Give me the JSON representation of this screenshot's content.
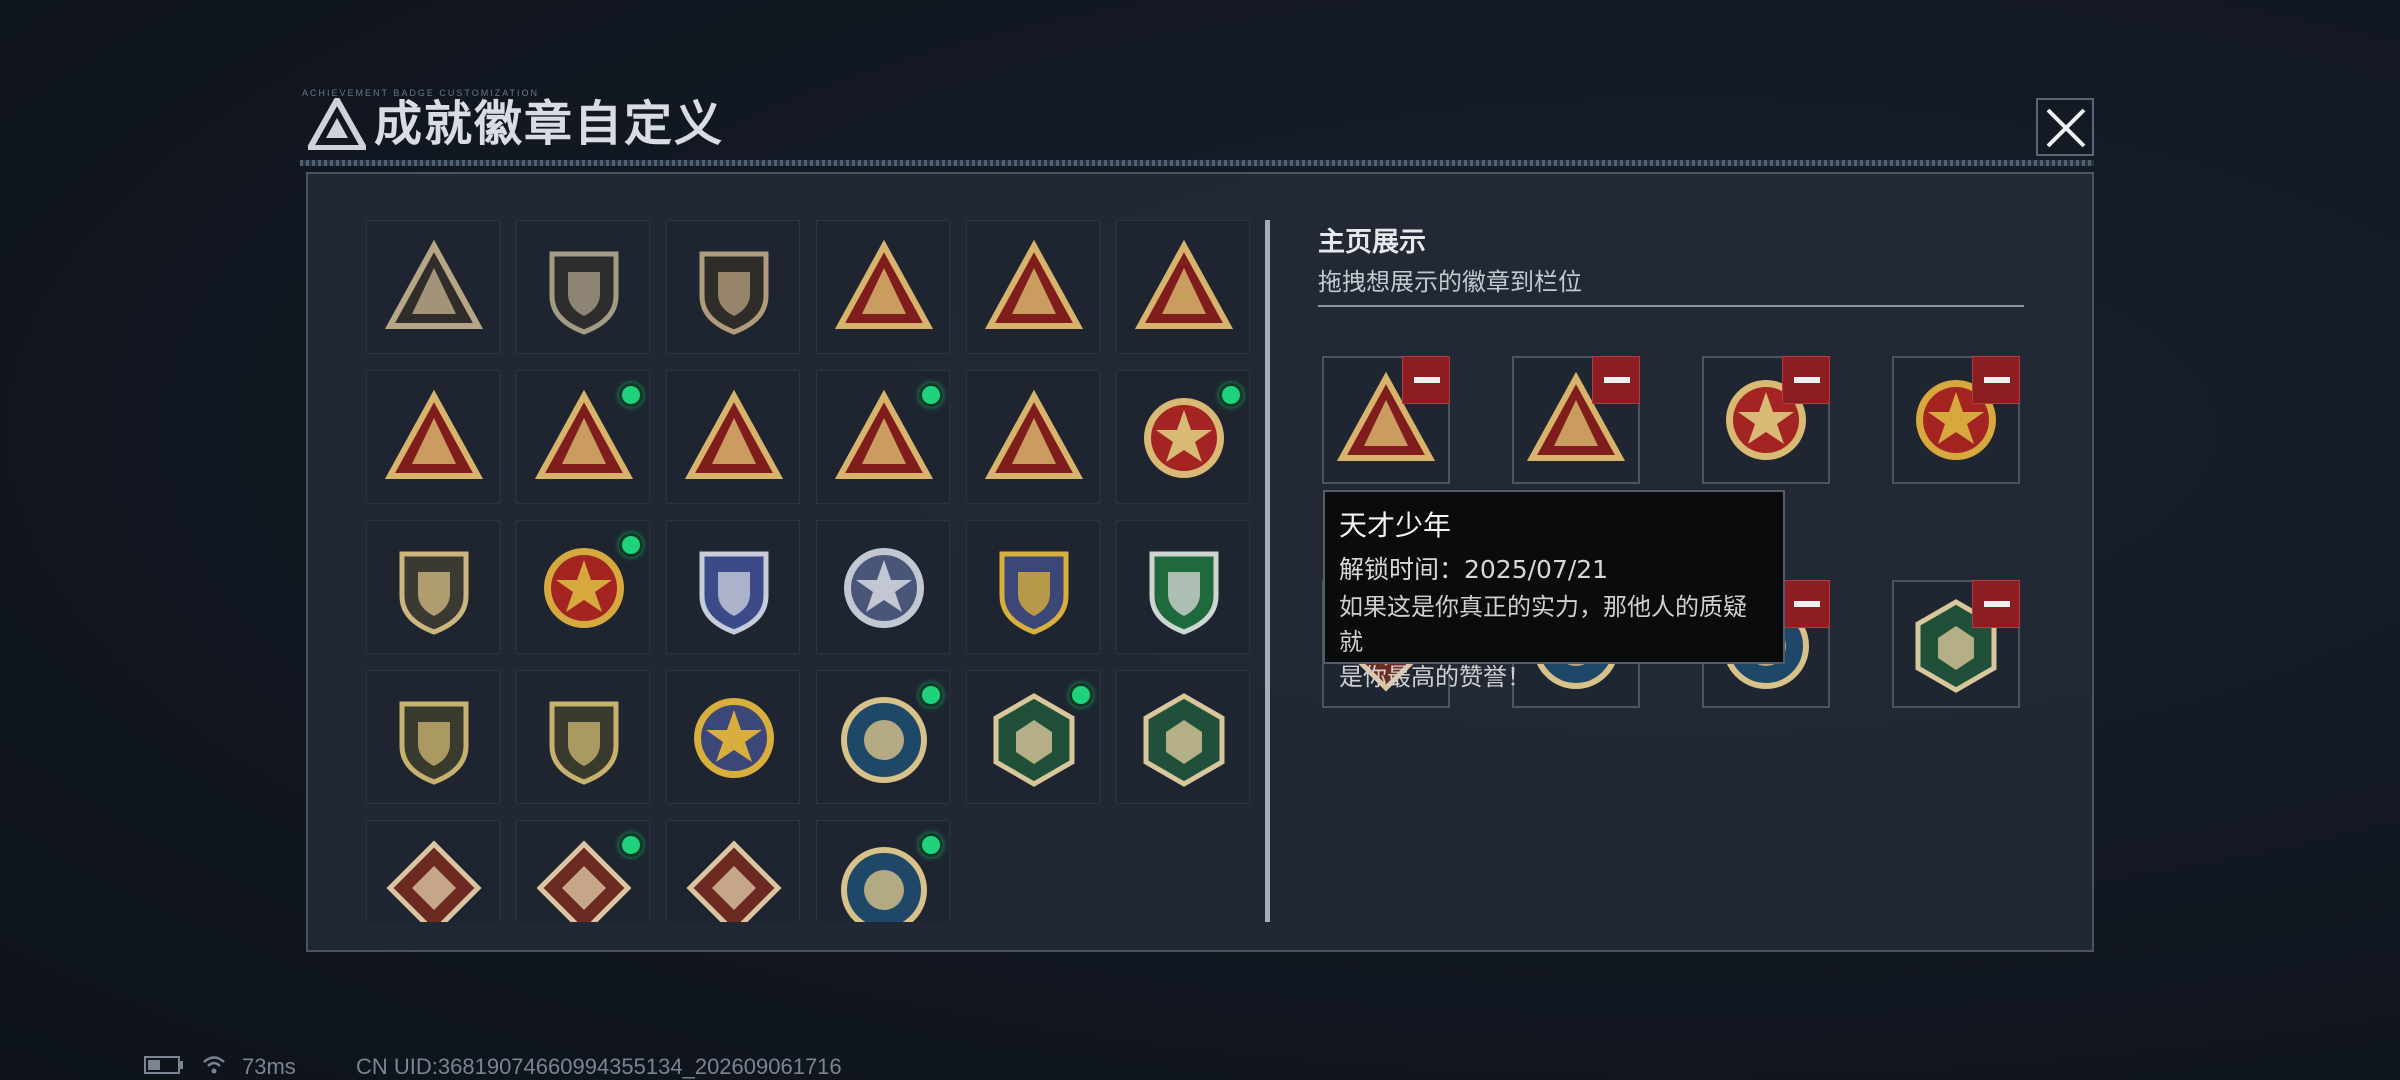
{
  "window": {
    "title": "成就徽章自定义",
    "title_small_print": "ACHIEVEMENT BADGE CUSTOMIZATION"
  },
  "badge_grid": {
    "badges": [
      {
        "icon": "triangle-logo-shield-badge",
        "new": false,
        "colors": [
          "#2f2c2a",
          "#b7a686"
        ]
      },
      {
        "icon": "helicopter-shield-badge",
        "new": false,
        "colors": [
          "#2d2d2e",
          "#a59a85"
        ]
      },
      {
        "icon": "dagger-shield-badge",
        "new": false,
        "colors": [
          "#2f2c2a",
          "#b09c7a"
        ]
      },
      {
        "icon": "usb-drive-triangle-badge",
        "new": false,
        "colors": [
          "#7f1d1c",
          "#d8b36b"
        ]
      },
      {
        "icon": "hand-triangle-badge",
        "new": false,
        "colors": [
          "#7f1d1c",
          "#d8b36b"
        ]
      },
      {
        "icon": "number-one-triangle-badge",
        "new": false,
        "colors": [
          "#7f1d1c",
          "#d8b36b"
        ]
      },
      {
        "icon": "number-two-triangle-badge",
        "new": false,
        "colors": [
          "#7f1d1c",
          "#d8b36b"
        ]
      },
      {
        "icon": "flash-drive-triangle-badge",
        "new": true,
        "colors": [
          "#7f1d1c",
          "#d8b36b"
        ]
      },
      {
        "icon": "runner-triangle-badge",
        "new": false,
        "colors": [
          "#7f1d1c",
          "#d8b36b"
        ]
      },
      {
        "icon": "hexagon-triangle-badge",
        "new": true,
        "colors": [
          "#7f1d1c",
          "#d8b36b"
        ]
      },
      {
        "icon": "soldiers-triangle-badge",
        "new": false,
        "colors": [
          "#7f1d1c",
          "#d8b36b"
        ]
      },
      {
        "icon": "star-wreath-badge",
        "new": true,
        "colors": [
          "#a32422",
          "#d9ba74"
        ]
      },
      {
        "icon": "golden-shield-badge",
        "new": false,
        "colors": [
          "#3b3a32",
          "#cdb57e"
        ]
      },
      {
        "icon": "winged-medal-badge",
        "new": true,
        "colors": [
          "#a42421",
          "#d6a83e"
        ]
      },
      {
        "icon": "silver-diamond-shield-badge",
        "new": false,
        "colors": [
          "#3c4a8a",
          "#c7ccd8"
        ]
      },
      {
        "icon": "silver-skull-badge",
        "new": false,
        "colors": [
          "#4a5679",
          "#c2c7d2"
        ]
      },
      {
        "icon": "gold-crossed-arms-shield-badge",
        "new": false,
        "colors": [
          "#3b4777",
          "#d8ae3d"
        ]
      },
      {
        "icon": "green-rifle-shield-badge",
        "new": false,
        "colors": [
          "#1f6a3d",
          "#cfd5d0"
        ]
      },
      {
        "icon": "rifle-circle-shield-badge",
        "new": false,
        "colors": [
          "#3a3b2f",
          "#c7b16e"
        ]
      },
      {
        "icon": "sniper-circle-shield-badge",
        "new": false,
        "colors": [
          "#3a3b2f",
          "#c7b16e"
        ]
      },
      {
        "icon": "blue-gold-emblem-badge",
        "new": false,
        "colors": [
          "#3b4777",
          "#d8ae3d"
        ]
      },
      {
        "icon": "eagle-circle-badge",
        "new": true,
        "colors": [
          "#1f4868",
          "#d8c28a"
        ]
      },
      {
        "icon": "hornet-hexagon-badge",
        "new": true,
        "colors": [
          "#21503a",
          "#d9c79b"
        ]
      },
      {
        "icon": "medic-hexagon-badge",
        "new": false,
        "colors": [
          "#21503a",
          "#d9c79b"
        ]
      },
      {
        "icon": "dragon-diamond-badge",
        "new": false,
        "colors": [
          "#6d2a22",
          "#dcc5a2"
        ]
      },
      {
        "icon": "dragon-diamond-badge-2",
        "new": true,
        "colors": [
          "#6d2a22",
          "#dcc5a2"
        ]
      },
      {
        "icon": "kick-diamond-badge",
        "new": false,
        "colors": [
          "#6d2a22",
          "#dcc5a2"
        ]
      },
      {
        "icon": "wolf-circle-badge",
        "new": true,
        "colors": [
          "#1f4868",
          "#d8c28a"
        ]
      }
    ]
  },
  "showcase": {
    "title": "主页展示",
    "subtitle": "拖拽想展示的徽章到栏位",
    "slots": [
      {
        "icon": "flash-drive-triangle-badge",
        "colors": [
          "#7f1d1c",
          "#d8b36b"
        ]
      },
      {
        "icon": "hexagon-triangle-badge",
        "colors": [
          "#7f1d1c",
          "#d8b36b"
        ]
      },
      {
        "icon": "star-wreath-badge",
        "colors": [
          "#a32422",
          "#d9ba74"
        ]
      },
      {
        "icon": "winged-medal-badge",
        "colors": [
          "#a42421",
          "#d6a83e"
        ]
      },
      {
        "icon": "dragon-diamond-badge",
        "colors": [
          "#6d2a22",
          "#dcc5a2"
        ]
      },
      {
        "icon": "eagle-circle-badge",
        "colors": [
          "#1f4868",
          "#d8c28a"
        ]
      },
      {
        "icon": "wolf-circle-badge",
        "colors": [
          "#1f4868",
          "#d8c28a"
        ]
      },
      {
        "icon": "hornet-hexagon-badge",
        "colors": [
          "#21503a",
          "#d9c79b"
        ]
      }
    ]
  },
  "tooltip": {
    "name": "天才少年",
    "unlock_time": "解锁时间：2025/07/21",
    "desc_line1": "如果这是你真正的实力，那他人的质疑就",
    "desc_line2": "是你最高的赞誉！"
  },
  "status_bar": {
    "ping": "73ms",
    "uid": "CN UID:3681907466099435513​4_202609061716"
  },
  "theme": {
    "accent_green": "#1ed37c",
    "remove_red": "#8b1e22"
  }
}
